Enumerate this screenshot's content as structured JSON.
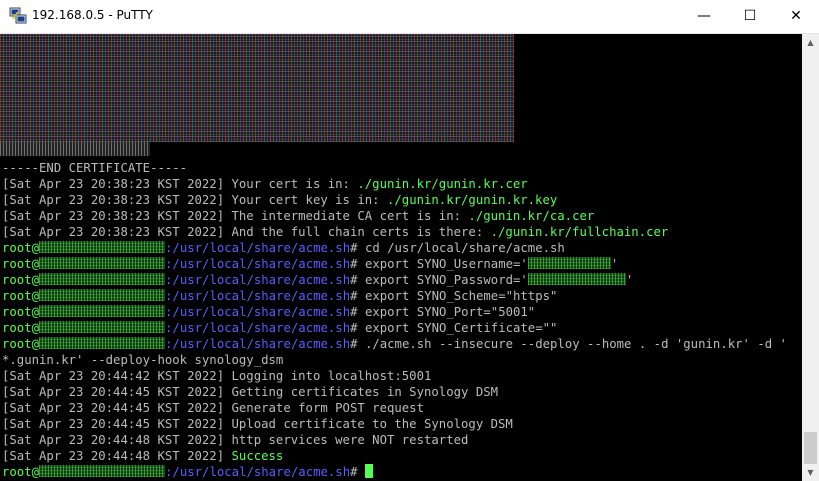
{
  "window": {
    "title": "192.168.0.5 - PuTTY",
    "icon": "putty-icon",
    "controls": {
      "minimize": "—",
      "maximize": "☐",
      "close": "✕"
    }
  },
  "terminal": {
    "colors": {
      "background": "#000000",
      "text": "#bbbbbb",
      "green": "#55ff55",
      "blue": "#5c5cff"
    },
    "end_certificate": "-----END CERTIFICATE-----",
    "cert_lines": [
      {
        "prefix": "[Sat Apr 23 20:38:23 KST 2022] Your cert is in: ",
        "path": "./gunin.kr/gunin.kr.cer"
      },
      {
        "prefix": "[Sat Apr 23 20:38:23 KST 2022] Your cert key is in: ",
        "path": "./gunin.kr/gunin.kr.key"
      },
      {
        "prefix": "[Sat Apr 23 20:38:23 KST 2022] The intermediate CA cert is in: ",
        "path": "./gunin.kr/ca.cer"
      },
      {
        "prefix": "[Sat Apr 23 20:38:23 KST 2022] And the full chain certs is there: ",
        "path": "./gunin.kr/fullchain.cer"
      }
    ],
    "prompt": {
      "user": "root@",
      "path": ":/usr/local/share/acme.sh",
      "symbol": "# "
    },
    "commands": {
      "cd": "cd /usr/local/share/acme.sh",
      "username_pre": "export SYNO_Username='",
      "username_post": "'",
      "password_pre": "export SYNO_Password='",
      "password_post": "'",
      "scheme": "export SYNO_Scheme=\"https\"",
      "port": "export SYNO_Port=\"5001\"",
      "certificate": "export SYNO_Certificate=\"\"",
      "deploy": "./acme.sh --insecure --deploy --home . -d 'gunin.kr' -d '",
      "deploy_cont": "*.gunin.kr' --deploy-hook synology_dsm"
    },
    "deploy_log": [
      "[Sat Apr 23 20:44:42 KST 2022] Logging into localhost:5001",
      "[Sat Apr 23 20:44:45 KST 2022] Getting certificates in Synology DSM",
      "[Sat Apr 23 20:44:45 KST 2022] Generate form POST request",
      "[Sat Apr 23 20:44:45 KST 2022] Upload certificate to the Synology DSM",
      "[Sat Apr 23 20:44:48 KST 2022] http services were NOT restarted"
    ],
    "success_line": {
      "prefix": "[Sat Apr 23 20:44:48 KST 2022] ",
      "status": "Success"
    }
  },
  "scrollbar": {
    "up_arrow": "▲",
    "down_arrow": "▼"
  }
}
